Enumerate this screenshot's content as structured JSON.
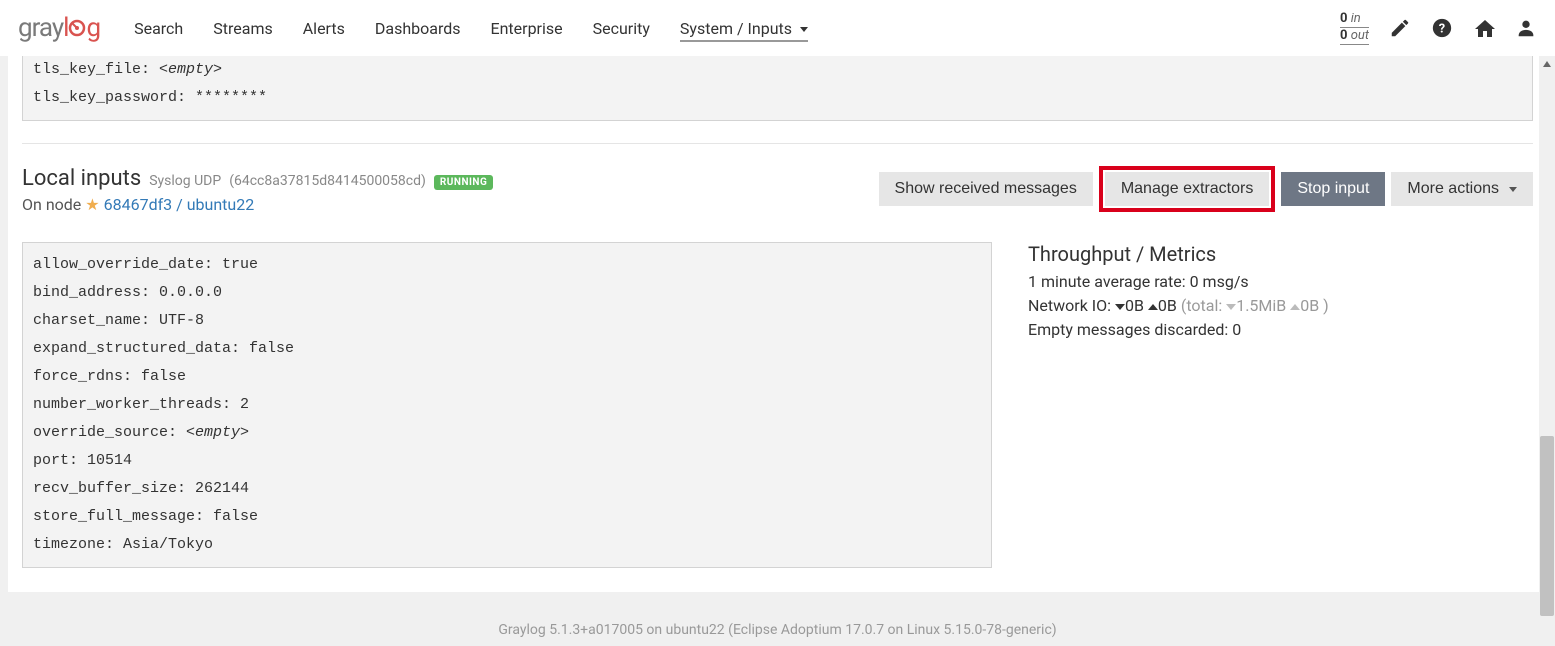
{
  "logo": {
    "part1": "gray",
    "part2": "l",
    "part3": "g"
  },
  "nav": [
    {
      "label": "Search",
      "active": false
    },
    {
      "label": "Streams",
      "active": false
    },
    {
      "label": "Alerts",
      "active": false
    },
    {
      "label": "Dashboards",
      "active": false
    },
    {
      "label": "Enterprise",
      "active": false
    },
    {
      "label": "Security",
      "active": false
    },
    {
      "label": "System / Inputs",
      "active": true,
      "dropdown": true
    }
  ],
  "io": {
    "in_count": "0",
    "in_label": "in",
    "out_count": "0",
    "out_label": "out"
  },
  "prev_config": [
    {
      "key": "tls_key_file:",
      "value": "<empty>",
      "empty": true
    },
    {
      "key": "tls_key_password:",
      "value": "********",
      "empty": false
    }
  ],
  "section": {
    "title": "Local inputs",
    "subtitle": "Syslog UDP",
    "id": "(64cc8a37815d8414500058cd)",
    "badge": "RUNNING",
    "node_prefix": "On node",
    "node_link": "68467df3 / ubuntu22"
  },
  "buttons": {
    "show_msgs": "Show received messages",
    "manage_ext": "Manage extractors",
    "stop_input": "Stop input",
    "more_actions": "More actions"
  },
  "config": [
    {
      "key": "allow_override_date:",
      "value": "true"
    },
    {
      "key": "bind_address:",
      "value": "0.0.0.0"
    },
    {
      "key": "charset_name:",
      "value": "UTF-8"
    },
    {
      "key": "expand_structured_data:",
      "value": "false"
    },
    {
      "key": "force_rdns:",
      "value": "false"
    },
    {
      "key": "number_worker_threads:",
      "value": "2"
    },
    {
      "key": "override_source:",
      "value": "<empty>",
      "empty": true
    },
    {
      "key": "port:",
      "value": "10514"
    },
    {
      "key": "recv_buffer_size:",
      "value": "262144"
    },
    {
      "key": "store_full_message:",
      "value": "false"
    },
    {
      "key": "timezone:",
      "value": "Asia/Tokyo"
    }
  ],
  "metrics": {
    "title": "Throughput / Metrics",
    "rate_label": "1 minute average rate:",
    "rate_value": "0 msg/s",
    "net_label": "Network IO:",
    "net_down": "0B",
    "net_up": "0B",
    "net_total_label": "(total:",
    "net_total_down": "1.5MiB",
    "net_total_up": "0B",
    "net_total_close": ")",
    "discard_label": "Empty messages discarded:",
    "discard_value": "0"
  },
  "footer": "Graylog 5.1.3+a017005 on ubuntu22 (Eclipse Adoptium 17.0.7 on Linux 5.15.0-78-generic)"
}
